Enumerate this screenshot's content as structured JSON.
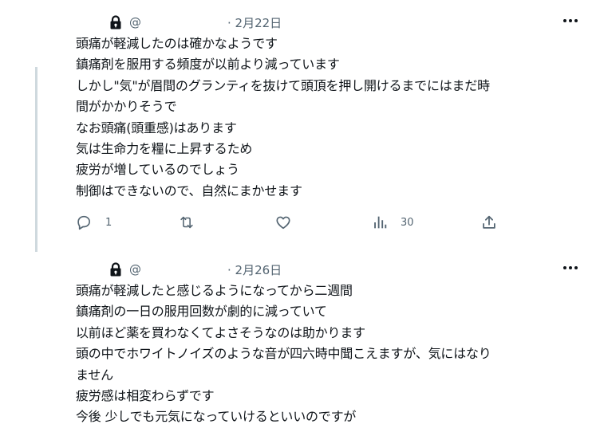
{
  "posts": [
    {
      "handle": "@",
      "date": "· 2月22日",
      "lines": [
        "頭痛が軽減したのは確かなようです",
        "鎮痛剤を服用する頻度が以前より減っています",
        "しかし\"気\"が眉間のグランティを抜けて頭頂を押し開けるまでにはまだ時",
        "間がかかりそうで",
        "なお頭痛(頭重感)はあります",
        "気は生命力を糧に上昇するため",
        "疲労が増しているのでしょう",
        "制御はできないので、自然にまかせます"
      ],
      "stats": {
        "reply_count": "1",
        "views_count": "30"
      }
    },
    {
      "handle": "@",
      "date": "· 2月26日",
      "lines": [
        "頭痛が軽減したと感じるようになってから二週間",
        "鎮痛剤の一日の服用回数が劇的に減っていて",
        "以前ほど薬を買わなくてよさそうなのは助かります",
        "頭の中でホワイトノイズのような音が四六時中聞こえますが、気にはなり",
        "ません",
        "疲労感は相変わらずです",
        "今後 少しでも元気になっていけるといいのですが"
      ]
    }
  ],
  "icons": {
    "lock": "lock-icon",
    "more": "more-icon",
    "reply": "reply-icon",
    "retweet": "retweet-icon",
    "like": "heart-icon",
    "views": "views-icon",
    "share": "share-icon"
  },
  "colors": {
    "text": "#0f1419",
    "secondary": "#536471",
    "thread_line": "#cfd9de"
  }
}
